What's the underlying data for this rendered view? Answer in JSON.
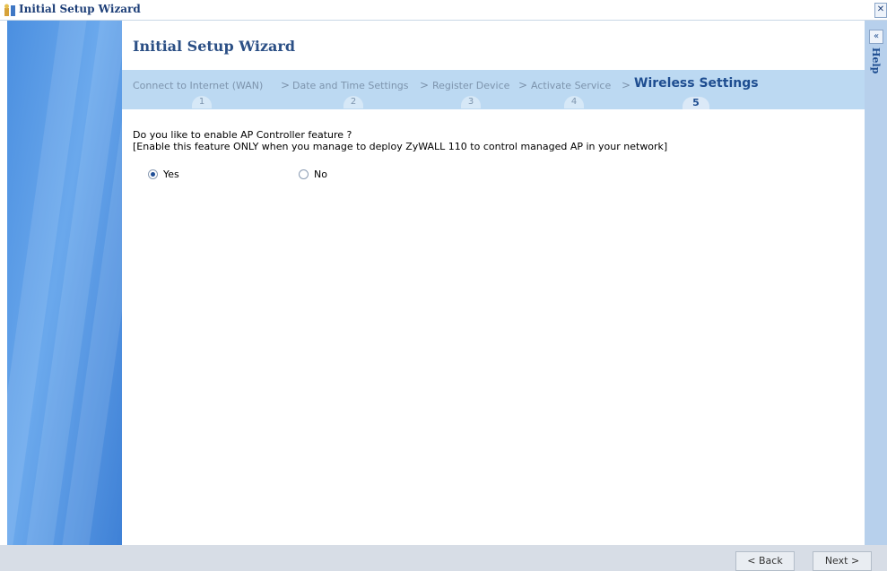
{
  "window": {
    "title": "Initial Setup Wizard",
    "close_glyph": "✕",
    "app_icon": "wizard-tools-icon"
  },
  "page": {
    "title": "Initial Setup Wizard"
  },
  "steps": [
    {
      "label": "Connect to Internet (WAN)",
      "number": "1",
      "active": false
    },
    {
      "label": "Date and Time Settings",
      "number": "2",
      "active": false
    },
    {
      "label": "Register Device",
      "number": "3",
      "active": false
    },
    {
      "label": "Activate Service",
      "number": "4",
      "active": false
    },
    {
      "label": "Wireless Settings",
      "number": "5",
      "active": true
    }
  ],
  "step_separator": ">",
  "question": {
    "line1": "Do you like to enable AP Controller feature ?",
    "line2": "[Enable this feature ONLY when you manage to deploy ZyWALL 110 to control managed AP in your network]"
  },
  "options": [
    {
      "label": "Yes",
      "selected": true
    },
    {
      "label": "No",
      "selected": false
    }
  ],
  "help": {
    "label": "Help",
    "collapse_glyph": "«"
  },
  "buttons": {
    "back": "< Back",
    "next": "Next >"
  },
  "colors": {
    "accent": "#1e4d90",
    "steps_bar": "#bcd9f2",
    "left_panel": "#4b8fe0"
  }
}
